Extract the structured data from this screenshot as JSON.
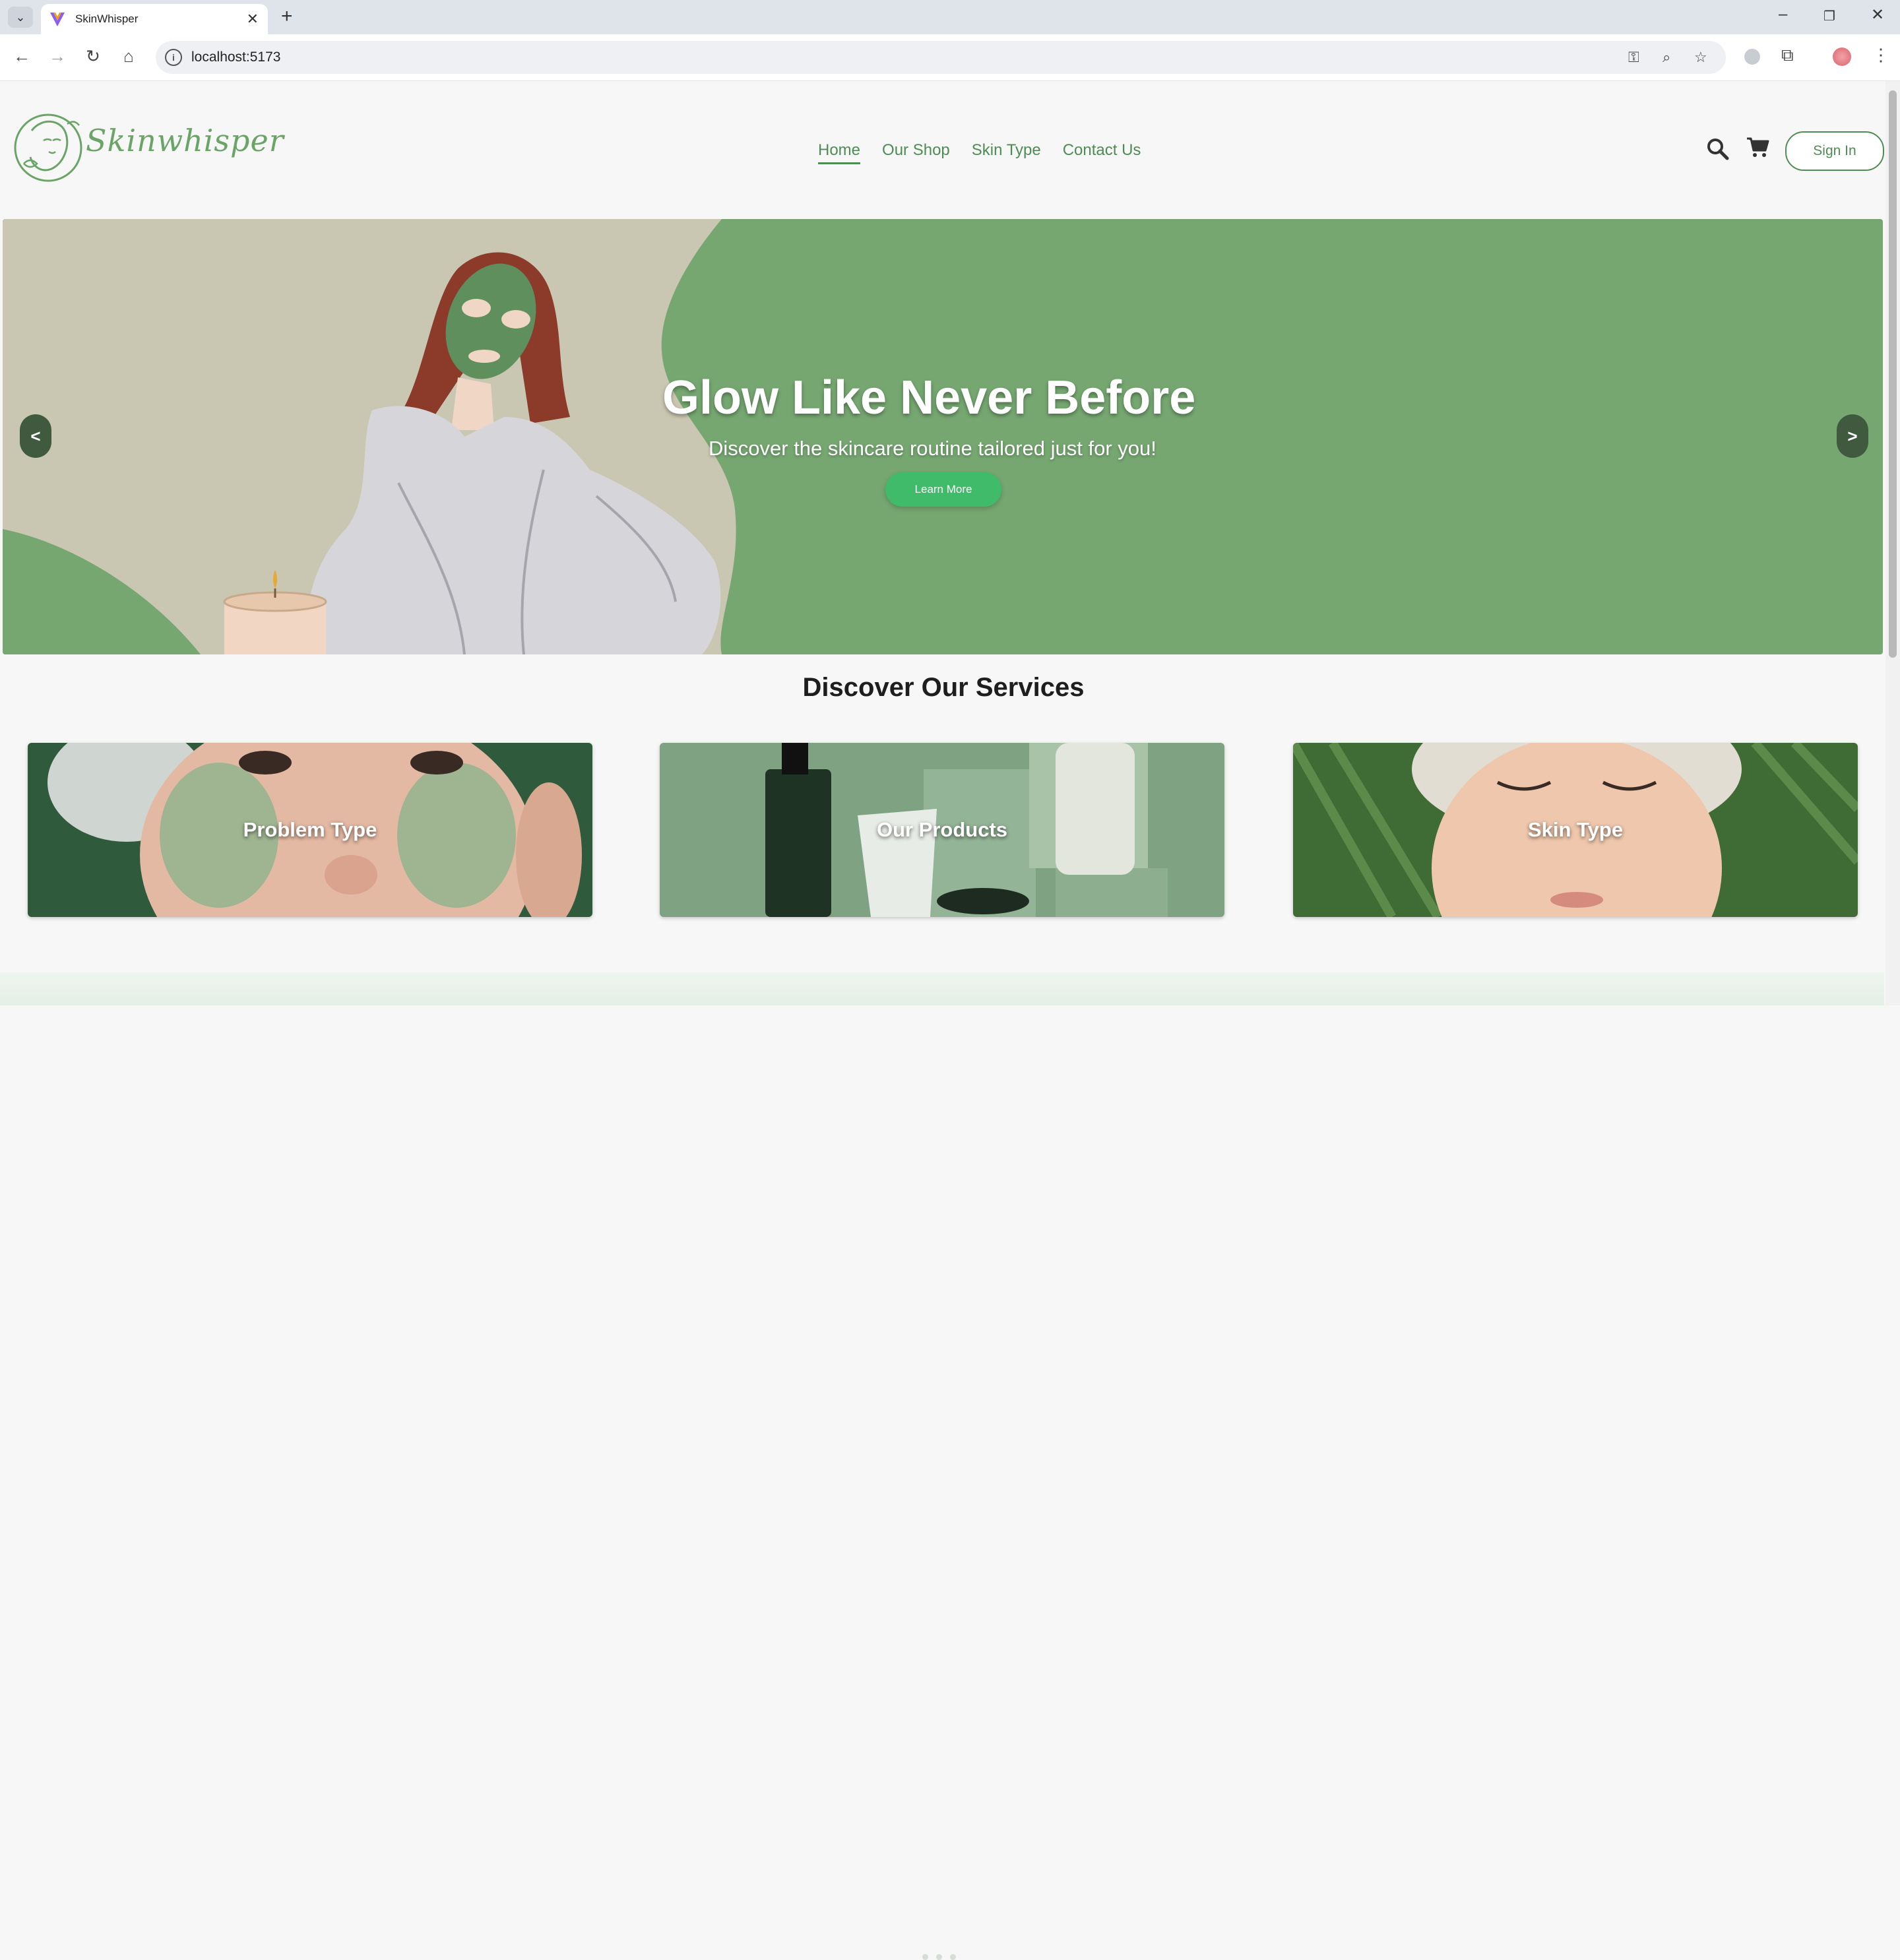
{
  "browser": {
    "tab_title": "SkinWhisper",
    "url": "localhost:5173",
    "tab_list_icon": "chevron-down-icon",
    "close_tab_icon": "close-icon",
    "new_tab_icon": "plus-icon"
  },
  "header": {
    "logo_text": "Skinwhisper",
    "nav": [
      {
        "label": "Home",
        "active": true
      },
      {
        "label": "Our Shop",
        "active": false
      },
      {
        "label": "Skin Type",
        "active": false
      },
      {
        "label": "Contact Us",
        "active": false
      }
    ],
    "sign_in_label": "Sign In"
  },
  "hero": {
    "title": "Glow Like Never Before",
    "subtitle": "Discover the skincare routine tailored just for you!",
    "button_label": "Learn More",
    "prev_label": "<",
    "next_label": ">"
  },
  "services": {
    "title": "Discover Our Services",
    "cards": [
      {
        "label": "Problem Type"
      },
      {
        "label": "Our Products"
      },
      {
        "label": "Skin Type"
      }
    ]
  },
  "colors": {
    "brand_green": "#4f8c55",
    "hero_green": "#76a771",
    "button_green": "#3fbb6a"
  }
}
